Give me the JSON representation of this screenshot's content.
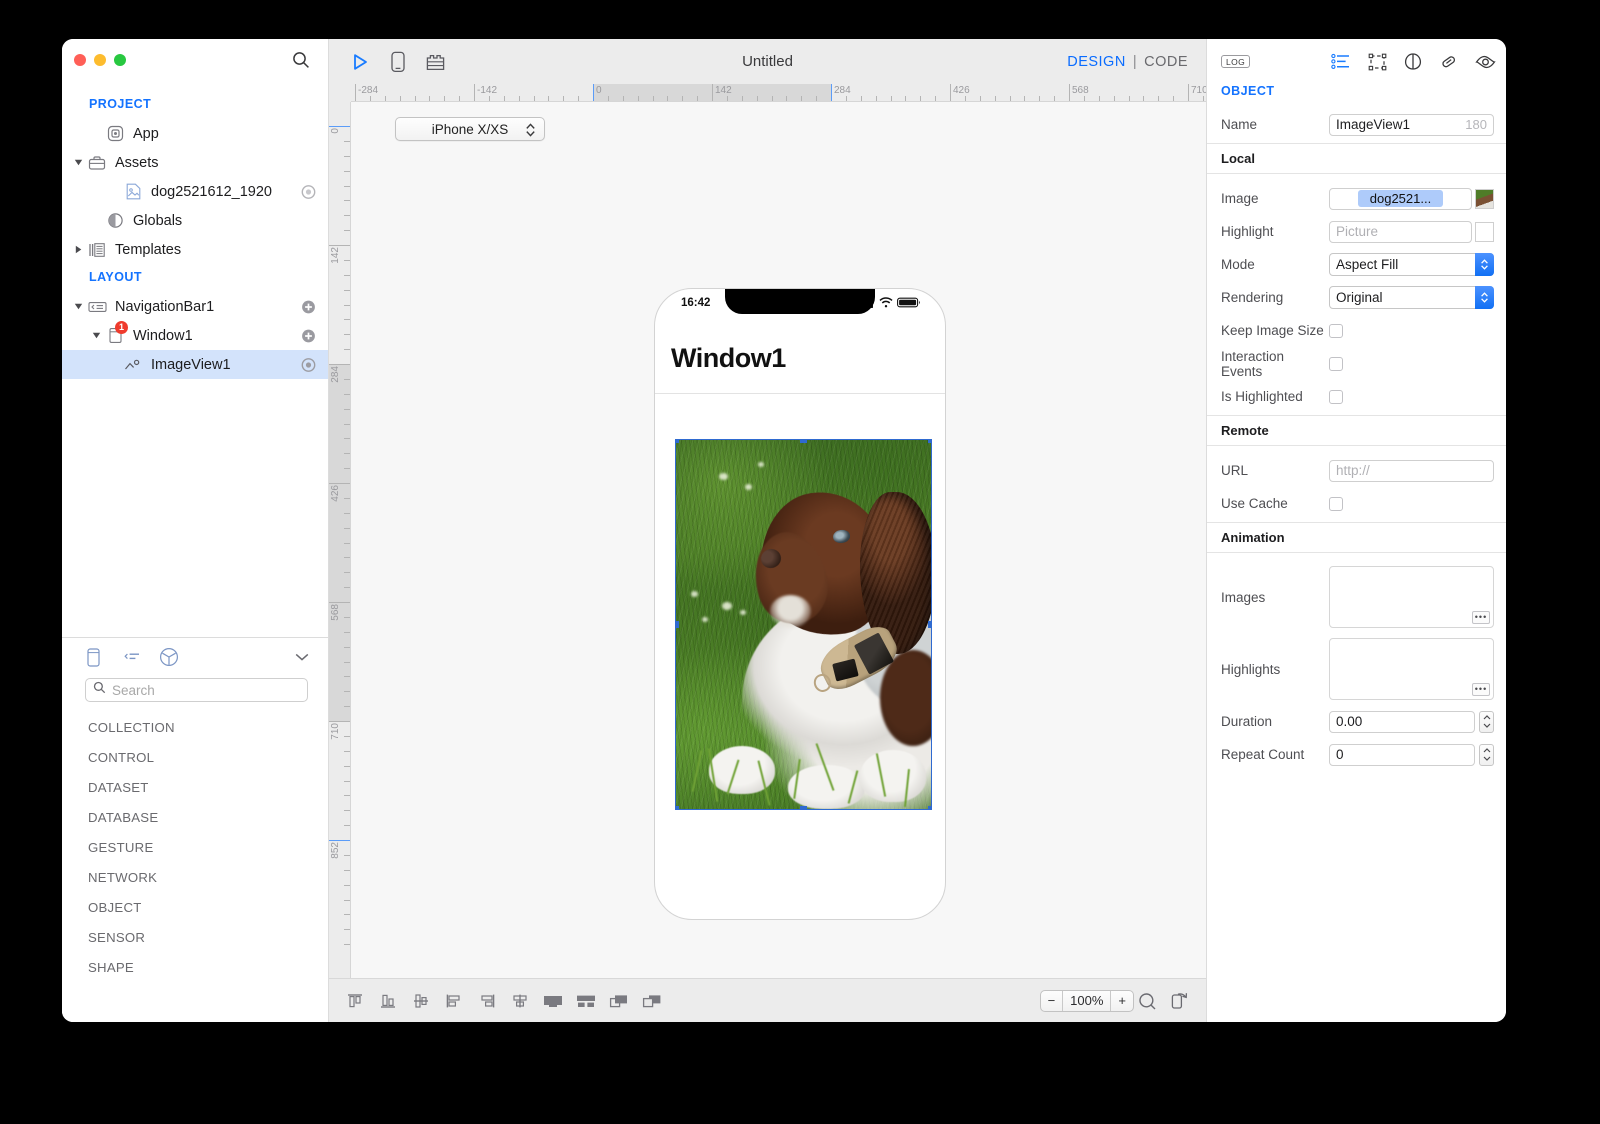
{
  "window": {
    "traffic": [
      "close",
      "minimize",
      "maximize"
    ]
  },
  "sidebar": {
    "search_icon": "search-icon",
    "groups": [
      {
        "title": "PROJECT",
        "items": [
          {
            "label": "App",
            "icon": "app-icon",
            "twisty": "none",
            "indent": 2,
            "trailing": "none"
          },
          {
            "label": "Assets",
            "icon": "briefcase-icon",
            "twisty": "open",
            "indent": 1,
            "trailing": "none"
          },
          {
            "label": "dog2521612_1920",
            "icon": "image-file-icon",
            "twisty": "none",
            "indent": 3,
            "trailing": "target"
          },
          {
            "label": "Globals",
            "icon": "globals-icon",
            "twisty": "none",
            "indent": 2,
            "trailing": "none"
          },
          {
            "label": "Templates",
            "icon": "templates-icon",
            "twisty": "closed",
            "indent": 1,
            "trailing": "none"
          }
        ]
      },
      {
        "title": "LAYOUT",
        "items": [
          {
            "label": "NavigationBar1",
            "icon": "navbar-icon",
            "twisty": "open",
            "indent": 1,
            "trailing": "plus"
          },
          {
            "label": "Window1",
            "icon": "window-icon",
            "twisty": "open",
            "indent": 2,
            "trailing": "plus",
            "badge": "1"
          },
          {
            "label": "ImageView1",
            "icon": "imageview-icon",
            "twisty": "none",
            "indent": 3,
            "trailing": "target",
            "selected": true
          }
        ]
      }
    ],
    "library": {
      "tabs": [
        "panel-icon",
        "list-icon",
        "cube-icon"
      ],
      "collapse_icon": "chevron-down-icon",
      "search_placeholder": "Search",
      "search_value": "",
      "categories": [
        "COLLECTION",
        "CONTROL",
        "DATASET",
        "DATABASE",
        "GESTURE",
        "NETWORK",
        "OBJECT",
        "SENSOR",
        "SHAPE"
      ]
    }
  },
  "center": {
    "toolbar": {
      "icons": [
        "play-icon",
        "device-icon",
        "library-icon"
      ],
      "title": "Untitled",
      "mode_design": "DESIGN",
      "mode_sep": "|",
      "mode_code": "CODE"
    },
    "ruler_h_labels": [
      "-284",
      "-142",
      "0",
      "142",
      "284",
      "426",
      "568",
      "710"
    ],
    "ruler_v_labels": [
      "0",
      "142",
      "284",
      "426",
      "568",
      "710",
      "852"
    ],
    "device_selector": {
      "value": "iPhone X/XS",
      "stepper_icon": "stepper-icon"
    },
    "phone": {
      "status_time": "16:42",
      "status_icons": [
        "cellular-icon",
        "wifi-icon",
        "battery-icon"
      ],
      "nav_title": "Window1",
      "image_alt": "dog2521612_1920"
    },
    "bottom": {
      "align_icons": [
        "align-top-icon",
        "align-bottom-icon",
        "align-vertical-center-icon",
        "align-left-icon",
        "align-right-icon",
        "align-horizontal-center-icon",
        "fill-container-icon",
        "distribute-horizontal-icon",
        "bring-forward-icon",
        "send-backward-icon"
      ],
      "zoom_minus": "−",
      "zoom_value": "100%",
      "zoom_plus": "+",
      "right_icons": [
        "zoom-loupe-icon",
        "device-rotate-icon"
      ]
    }
  },
  "inspector": {
    "log_label": "LOG",
    "icons": [
      "list-properties-icon",
      "bounds-icon",
      "appearance-icon",
      "link-icon",
      "preview-icon"
    ],
    "title": "OBJECT",
    "name_row": {
      "label": "Name",
      "value": "ImageView1",
      "right_num": "180"
    },
    "sections": [
      {
        "title": "Local",
        "rows": [
          {
            "label": "Image",
            "type": "chip-field",
            "value": "dog2521...",
            "thumb": true
          },
          {
            "label": "Highlight",
            "type": "field",
            "placeholder": "Picture",
            "value": "",
            "thumb_empty": true
          },
          {
            "label": "Mode",
            "type": "popup",
            "value": "Aspect Fill"
          },
          {
            "label": "Rendering",
            "type": "popup",
            "value": "Original"
          },
          {
            "label": "Keep Image Size",
            "type": "checkbox",
            "checked": false
          },
          {
            "label": "Interaction Events",
            "type": "checkbox",
            "checked": false
          },
          {
            "label": "Is Highlighted",
            "type": "checkbox",
            "checked": false
          }
        ]
      },
      {
        "title": "Remote",
        "rows": [
          {
            "label": "URL",
            "type": "field",
            "placeholder": "http://",
            "value": ""
          },
          {
            "label": "Use Cache",
            "type": "checkbox",
            "checked": false
          }
        ]
      },
      {
        "title": "Animation",
        "rows": [
          {
            "label": "Images",
            "type": "bigbox",
            "ellipsis": "•••"
          },
          {
            "label": "Highlights",
            "type": "bigbox",
            "ellipsis": "•••"
          },
          {
            "label": "Duration",
            "type": "stepper",
            "value": "0.00"
          },
          {
            "label": "Repeat Count",
            "type": "stepper",
            "value": "0"
          }
        ]
      }
    ]
  },
  "colors": {
    "accent_blue": "#1473ff",
    "selection_blue": "#d3e3fb",
    "handle_blue": "#2f6ad0",
    "badge_red": "#ef3b2d",
    "chip_blue": "#aecbfa"
  }
}
